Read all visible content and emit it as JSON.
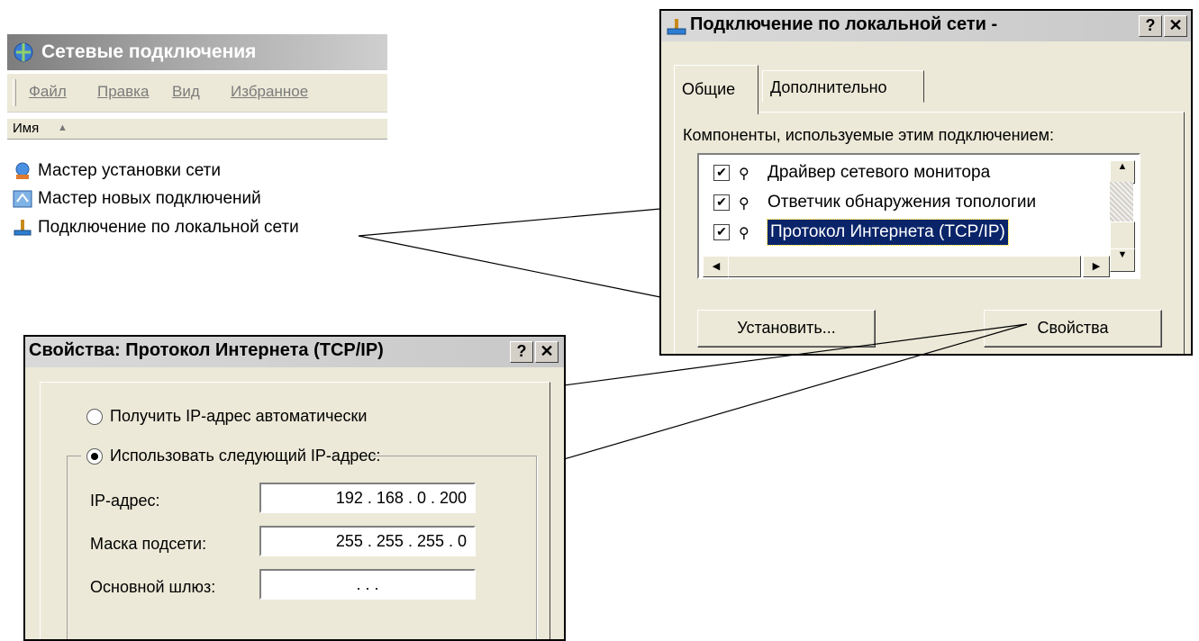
{
  "explorer": {
    "title": "Сетевые подключения",
    "menu": {
      "file": "Файл",
      "edit": "Правка",
      "view": "Вид",
      "favorites": "Избранное"
    },
    "column_name": "Имя",
    "items": [
      {
        "label": "Мастер установки сети",
        "icon": "network-wizard-icon"
      },
      {
        "label": "Мастер новых подключений",
        "icon": "new-connection-wizard-icon"
      },
      {
        "label": "Подключение по локальной сети",
        "icon": "lan-connection-icon"
      }
    ]
  },
  "connection_dialog": {
    "title": "Подключение по локальной сети -",
    "help_btn": "?",
    "close_btn": "✕",
    "tabs": [
      "Общие",
      "Дополнительно"
    ],
    "components_label": "Компоненты, используемые этим подключением:",
    "components": [
      {
        "label": "Драйвер сетевого монитора",
        "checked": true
      },
      {
        "label": "Ответчик обнаружения топологии",
        "checked": true
      },
      {
        "label": "Протокол Интернета (TCP/IP)",
        "checked": true,
        "selected": true
      }
    ],
    "install_btn": "Установить...",
    "properties_btn": "Свойства"
  },
  "tcp_dialog": {
    "title": "Свойства: Протокол Интернета (TCP/IP)",
    "help_btn": "?",
    "close_btn": "✕",
    "radio_auto": "Получить IP-адрес автоматически",
    "radio_manual": "Использовать следующий IP-адрес:",
    "selected_radio": "manual",
    "fields": [
      {
        "label": "IP-адрес:",
        "value": "192 . 168 .  0  . 200"
      },
      {
        "label": "Маска подсети:",
        "value": "255 . 255 . 255 .  0"
      },
      {
        "label": "Основной шлюз:",
        "value": ".        .        ."
      }
    ]
  },
  "colors": {
    "selection": "#0a246a",
    "dialog_bg": "#ece9d8"
  }
}
